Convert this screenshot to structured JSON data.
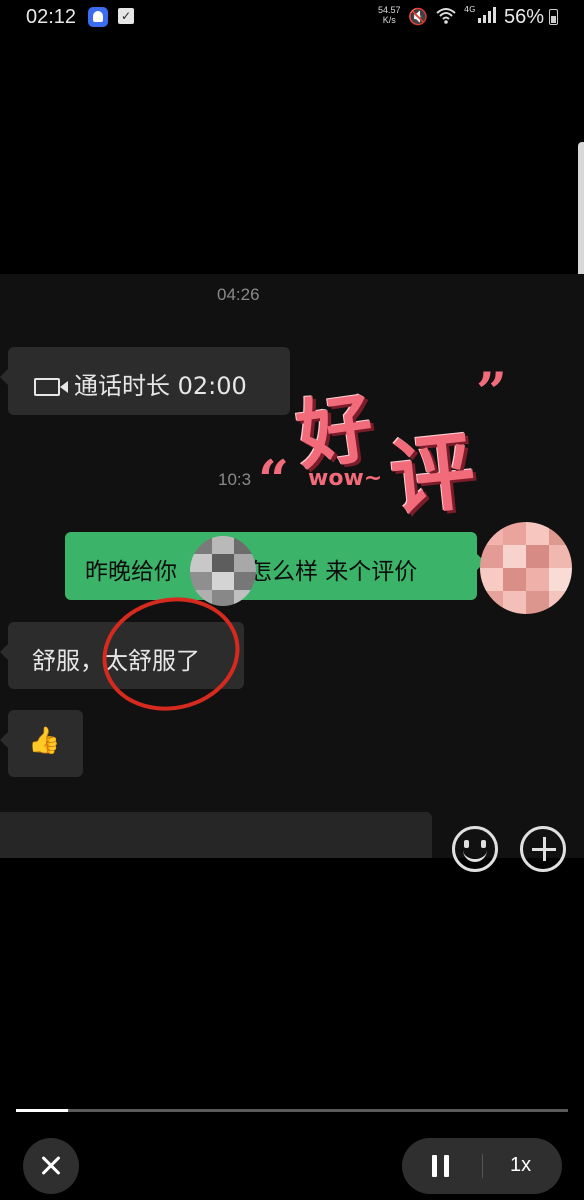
{
  "status_bar": {
    "time": "02:12",
    "net_speed_value": "54.57",
    "net_speed_unit": "K/s",
    "network_type": "4G",
    "battery_percent": "56%",
    "icons": [
      "ghost-app-icon",
      "checkbox-app-icon",
      "mute-icon",
      "wifi-icon",
      "signal-icon",
      "battery-icon"
    ]
  },
  "chat": {
    "timestamp_1": "04:26",
    "call_bubble_text": "通话时长 02:00",
    "timestamp_2": "10:3",
    "outgoing_message_part1": "昨晚给你",
    "outgoing_message_part2": "怎么样 来个评价",
    "incoming_message_1": "舒服，太舒服了",
    "incoming_message_2_emoji": "👍"
  },
  "sticker": {
    "text_1": "好",
    "text_2": "评",
    "text_3": "wow~",
    "quote_open": "“",
    "quote_close": "”"
  },
  "player": {
    "progress": 0.095,
    "speed": "1x"
  },
  "colors": {
    "outgoing_bubble": "#3bb46a",
    "incoming_bubble": "#2c2c2c",
    "annotation_circle": "#d62a1f",
    "sticker_pink": "#f26b7a"
  }
}
